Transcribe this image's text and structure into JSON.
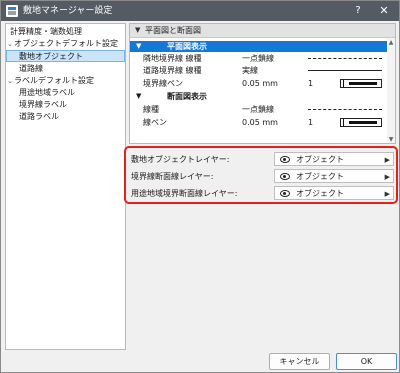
{
  "window": {
    "title": "敷地マネージャー設定",
    "help_glyph": "?",
    "close_glyph": "✕"
  },
  "tree": {
    "items": [
      {
        "label": "計算精度・端数処理",
        "chevron": ""
      },
      {
        "label": "オブジェクトデフォルト設定",
        "chevron": "⌄"
      },
      {
        "label": "敷地オブジェクト",
        "chevron": ""
      },
      {
        "label": "道路線",
        "chevron": ""
      },
      {
        "label": "ラベルデフォルト設定",
        "chevron": "⌄"
      },
      {
        "label": "用途地域ラベル",
        "chevron": ""
      },
      {
        "label": "境界線ラベル",
        "chevron": ""
      },
      {
        "label": "道路ラベル",
        "chevron": ""
      }
    ]
  },
  "props": {
    "section_label": "平面図と断面図",
    "groups": {
      "plan": "平面図表示",
      "section": "断面図表示"
    },
    "rows": {
      "neighbor_line_type": {
        "name": "隣地境界線 線種",
        "value": "一点鎖線"
      },
      "road_line_type": {
        "name": "道路境界線 線種",
        "value": "実線"
      },
      "boundary_pen": {
        "name": "境界線ペン",
        "value": "0.05 mm",
        "extra": "1"
      },
      "section_line_type": {
        "name": "線種",
        "value": "一点鎖線"
      },
      "section_pen": {
        "name": "線ペン",
        "value": "0.05 mm",
        "extra": "1"
      }
    }
  },
  "layers": {
    "rows": [
      {
        "label": "敷地オブジェクトレイヤー:",
        "value": "オブジェクト"
      },
      {
        "label": "境界線断面線レイヤー:",
        "value": "オブジェクト"
      },
      {
        "label": "用途地域境界断面線レイヤー:",
        "value": "オブジェクト"
      }
    ]
  },
  "buttons": {
    "cancel": "キャンセル",
    "ok": "OK"
  },
  "colors": {
    "accent_blue": "#1478d6",
    "highlight_red": "#e0221c",
    "titlebar": "#555b63"
  }
}
